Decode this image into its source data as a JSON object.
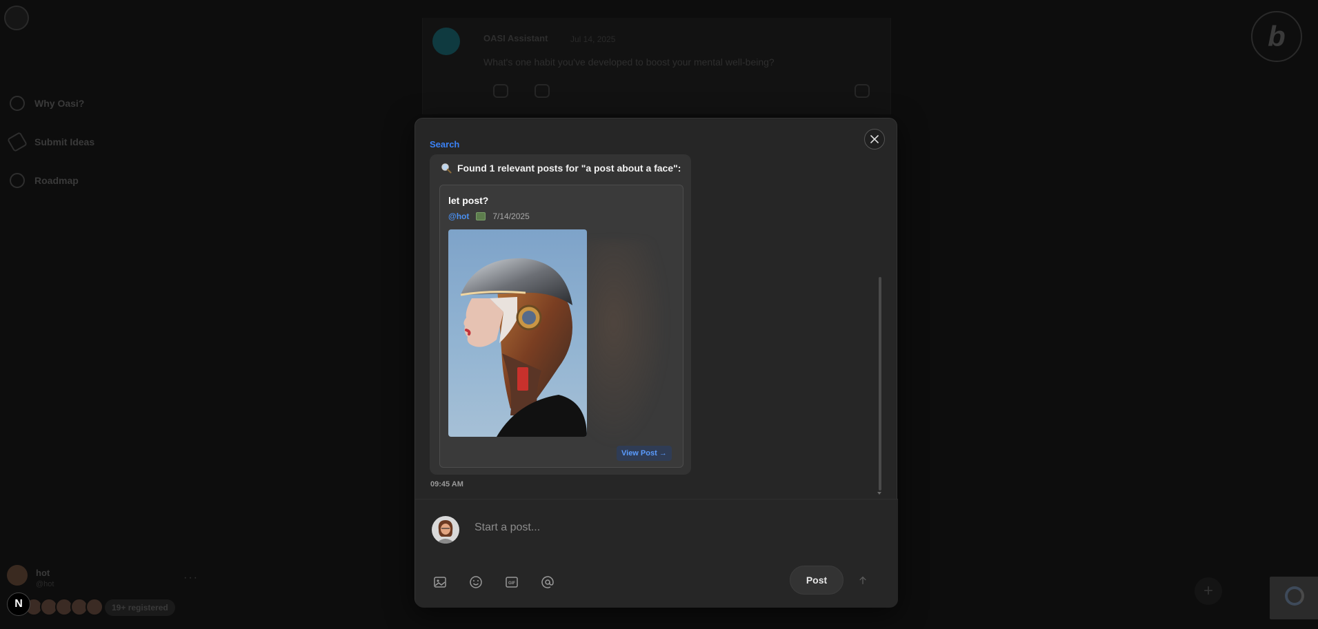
{
  "background": {
    "nav_items": [
      {
        "label": "Why Oasi?",
        "icon": "info-icon"
      },
      {
        "label": "Submit Ideas",
        "icon": "pencil-icon"
      },
      {
        "label": "Roadmap",
        "icon": "roadmap-icon"
      }
    ],
    "feed_post": {
      "author": "OASI Assistant",
      "meta": "Jul 14, 2025",
      "text": "What's one habit you've developed to boost your mental well-being?"
    },
    "brand_letter": "b",
    "user": {
      "name": "hot",
      "handle": "@hot"
    },
    "registered_badge": "19+ registered",
    "next_badge": "N",
    "fab_label": "+"
  },
  "modal": {
    "search_label": "Search",
    "result_header": "Found 1 relevant posts for \"a post about a face\":",
    "post": {
      "title": "let post?",
      "author": "@hot",
      "date": "7/14/2025",
      "image_subject": "robot-profile-image",
      "view_button": "View Post →"
    },
    "timestamp": "09:45 AM",
    "composer": {
      "placeholder": "Start a post...",
      "post_button": "Post",
      "tools": [
        "image-icon",
        "emoji-icon",
        "gif-icon",
        "mention-icon"
      ]
    }
  },
  "colors": {
    "accent": "#3b82f6",
    "modal_bg": "#262626",
    "bubble_bg": "#333333"
  }
}
